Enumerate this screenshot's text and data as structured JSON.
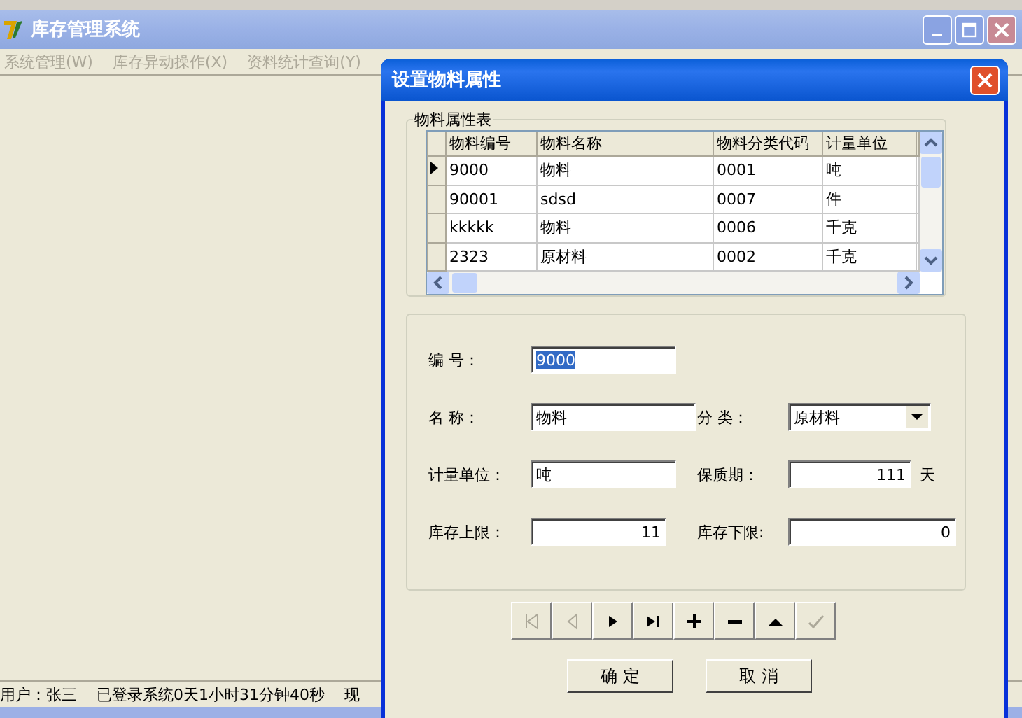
{
  "main_window": {
    "title": "库存管理系统",
    "active": false
  },
  "menu": [
    "系统管理(W)",
    "库存异动操作(X)",
    "资料统计查询(Y)"
  ],
  "status_bar": {
    "user": "用户：张三",
    "session": "已登录系统0天1小时31分钟40秒",
    "now": "现"
  },
  "dialog": {
    "title": "设置物料属性",
    "grid": {
      "caption": "物料属性表",
      "columns": [
        "物料编号",
        "物料名称",
        "物料分类代码",
        "计量单位"
      ],
      "rows": [
        {
          "cells": [
            "9000",
            "物料",
            "0001",
            "吨"
          ],
          "selected": true
        },
        {
          "cells": [
            "90001",
            "sdsd",
            "0007",
            "件"
          ],
          "selected": false
        },
        {
          "cells": [
            "kkkkk",
            "物料",
            "0006",
            "千克"
          ],
          "selected": false
        },
        {
          "cells": [
            "2323",
            "原材料",
            "0002",
            "千克"
          ],
          "selected": false
        }
      ]
    },
    "form": [
      [
        {
          "label": "编 号：",
          "value": "9000",
          "highlighted": true,
          "kind": "text"
        }
      ],
      [
        {
          "label": "名 称：",
          "value": "物料",
          "kind": "text"
        },
        {
          "label": "分 类：",
          "value": "原材料",
          "kind": "combo"
        }
      ],
      [
        {
          "label": "计量单位：",
          "value": "吨",
          "kind": "text"
        },
        {
          "label": "保质期：",
          "value": "111",
          "kind": "number",
          "unit": "天"
        }
      ],
      [
        {
          "label": "库存上限：",
          "value": "11",
          "kind": "number"
        },
        {
          "label": "库存下限:",
          "value": "0",
          "kind": "number"
        }
      ]
    ],
    "navigator": [
      {
        "kind": "first",
        "disabled": true
      },
      {
        "kind": "prior",
        "disabled": true
      },
      {
        "kind": "next",
        "disabled": false
      },
      {
        "kind": "last",
        "disabled": false
      },
      {
        "kind": "insert",
        "disabled": false
      },
      {
        "kind": "delete",
        "disabled": false
      },
      {
        "kind": "edit",
        "disabled": false
      },
      {
        "kind": "post",
        "disabled": true
      }
    ],
    "buttons": [
      "确 定",
      "取 消"
    ]
  }
}
